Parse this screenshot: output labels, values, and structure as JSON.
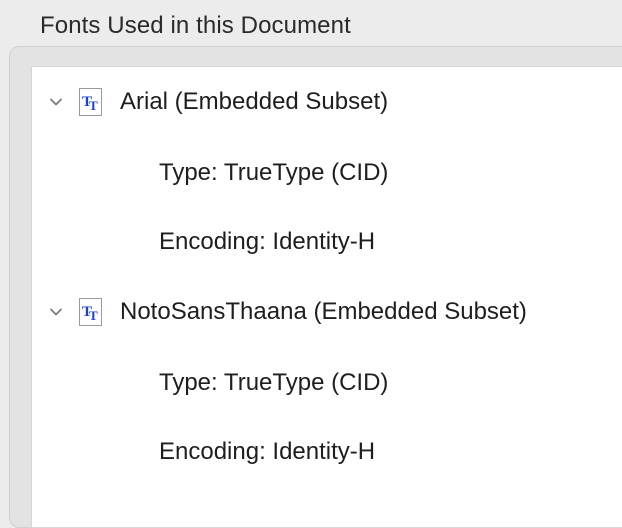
{
  "panel": {
    "title": "Fonts Used in this Document"
  },
  "fonts": [
    {
      "name": "Arial (Embedded Subset)",
      "type": "Type: TrueType (CID)",
      "encoding": "Encoding: Identity-H",
      "expanded": true,
      "icon": "truetype-font-icon"
    },
    {
      "name": "NotoSansThaana (Embedded Subset)",
      "type": "Type: TrueType (CID)",
      "encoding": "Encoding: Identity-H",
      "expanded": true,
      "icon": "truetype-font-icon"
    }
  ],
  "colors": {
    "icon_glyph": "#1a3fd6",
    "window_bg": "#ececec",
    "list_bg": "#ffffff"
  }
}
